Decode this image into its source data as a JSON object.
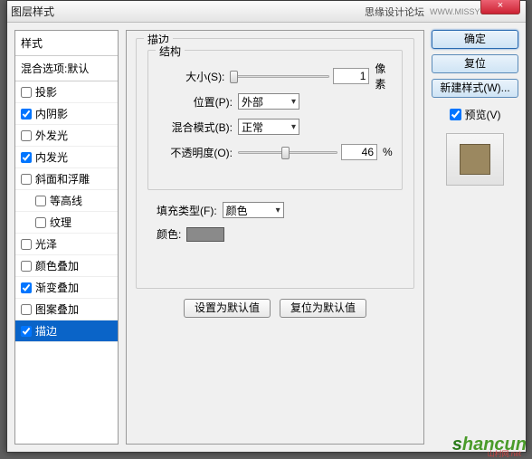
{
  "titlebar": {
    "title": "图层样式",
    "forum": "思缘设计论坛",
    "url": "WWW.MISSYUAN.COM",
    "close": "×"
  },
  "left": {
    "header": "样式",
    "default": "混合选项:默认",
    "items": [
      {
        "label": "投影",
        "checked": false
      },
      {
        "label": "内阴影",
        "checked": true
      },
      {
        "label": "外发光",
        "checked": false
      },
      {
        "label": "内发光",
        "checked": true
      },
      {
        "label": "斜面和浮雕",
        "checked": false
      },
      {
        "label": "等高线",
        "checked": false,
        "indent": true
      },
      {
        "label": "纹理",
        "checked": false,
        "indent": true
      },
      {
        "label": "光泽",
        "checked": false
      },
      {
        "label": "颜色叠加",
        "checked": false
      },
      {
        "label": "渐变叠加",
        "checked": true
      },
      {
        "label": "图案叠加",
        "checked": false
      },
      {
        "label": "描边",
        "checked": true,
        "selected": true
      }
    ]
  },
  "mid": {
    "panel_title": "描边",
    "structure": "结构",
    "size_label": "大小(S):",
    "size_value": "1",
    "size_unit": "像素",
    "position_label": "位置(P):",
    "position_value": "外部",
    "blend_label": "混合模式(B):",
    "blend_value": "正常",
    "opacity_label": "不透明度(O):",
    "opacity_value": "46",
    "opacity_unit": "%",
    "fill_label": "填充类型(F):",
    "fill_value": "颜色",
    "color_label": "颜色:",
    "set_default": "设置为默认值",
    "reset_default": "复位为默认值"
  },
  "right": {
    "ok": "确定",
    "cancel": "复位",
    "new_style": "新建样式(W)...",
    "preview_label": "预览(V)"
  },
  "watermark": {
    "text": "shancun",
    "sub": "山村网.net"
  }
}
